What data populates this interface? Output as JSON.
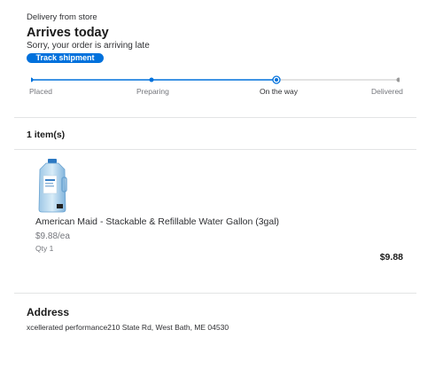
{
  "order": {
    "delivery_from": "Delivery from store",
    "arrives": "Arrives today",
    "status_message": "Sorry, your order is arriving late",
    "track_label": "Track shipment"
  },
  "progress": {
    "current_step_index": 2,
    "steps": [
      {
        "label": "Placed"
      },
      {
        "label": "Preparing"
      },
      {
        "label": "On the way"
      },
      {
        "label": "Delivered"
      }
    ],
    "colors": {
      "complete": "#0071dc",
      "pending": "#c4c4c4"
    }
  },
  "items": {
    "count_label": "1 item(s)",
    "list": [
      {
        "image_icon": "water-jug-image",
        "name": "American Maid - Stackable & Refillable Water Gallon (3gal)",
        "unit_price": "$9.88/ea",
        "qty": "Qty 1",
        "total": "$9.88"
      }
    ]
  },
  "address": {
    "title": "Address",
    "text": "xcellerated performance210 State Rd, West Bath, ME 04530"
  },
  "colors": {
    "accent": "#0071dc",
    "text": "#2e2f32",
    "muted": "#74767c",
    "divider": "#e3e4e5"
  }
}
